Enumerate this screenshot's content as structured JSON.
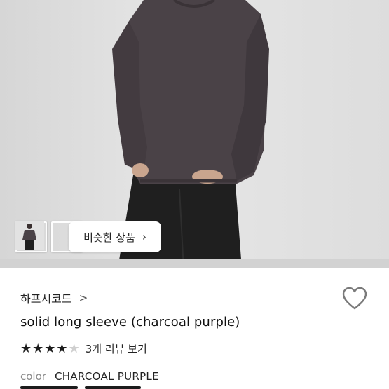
{
  "gallery": {
    "similar_button_label": "비슷한 상품",
    "similar_button_icon": "chevron-right-icon",
    "thumbnail_count": 2
  },
  "product": {
    "shop_name": "하프시코드",
    "shop_chevron": ">",
    "title": "solid long sleeve (charcoal purple)",
    "rating": 4,
    "rating_max": 5,
    "reviews_link": "3개 리뷰 보기",
    "color_label": "color",
    "color_value": "CHARCOAL PURPLE",
    "favorite_icon": "heart-outline-icon"
  },
  "colors": {
    "shirt": "#4a4247",
    "pants": "#1e1e1e",
    "background": "#e4e4e4",
    "text": "#222222",
    "muted": "#8a8a8a"
  }
}
